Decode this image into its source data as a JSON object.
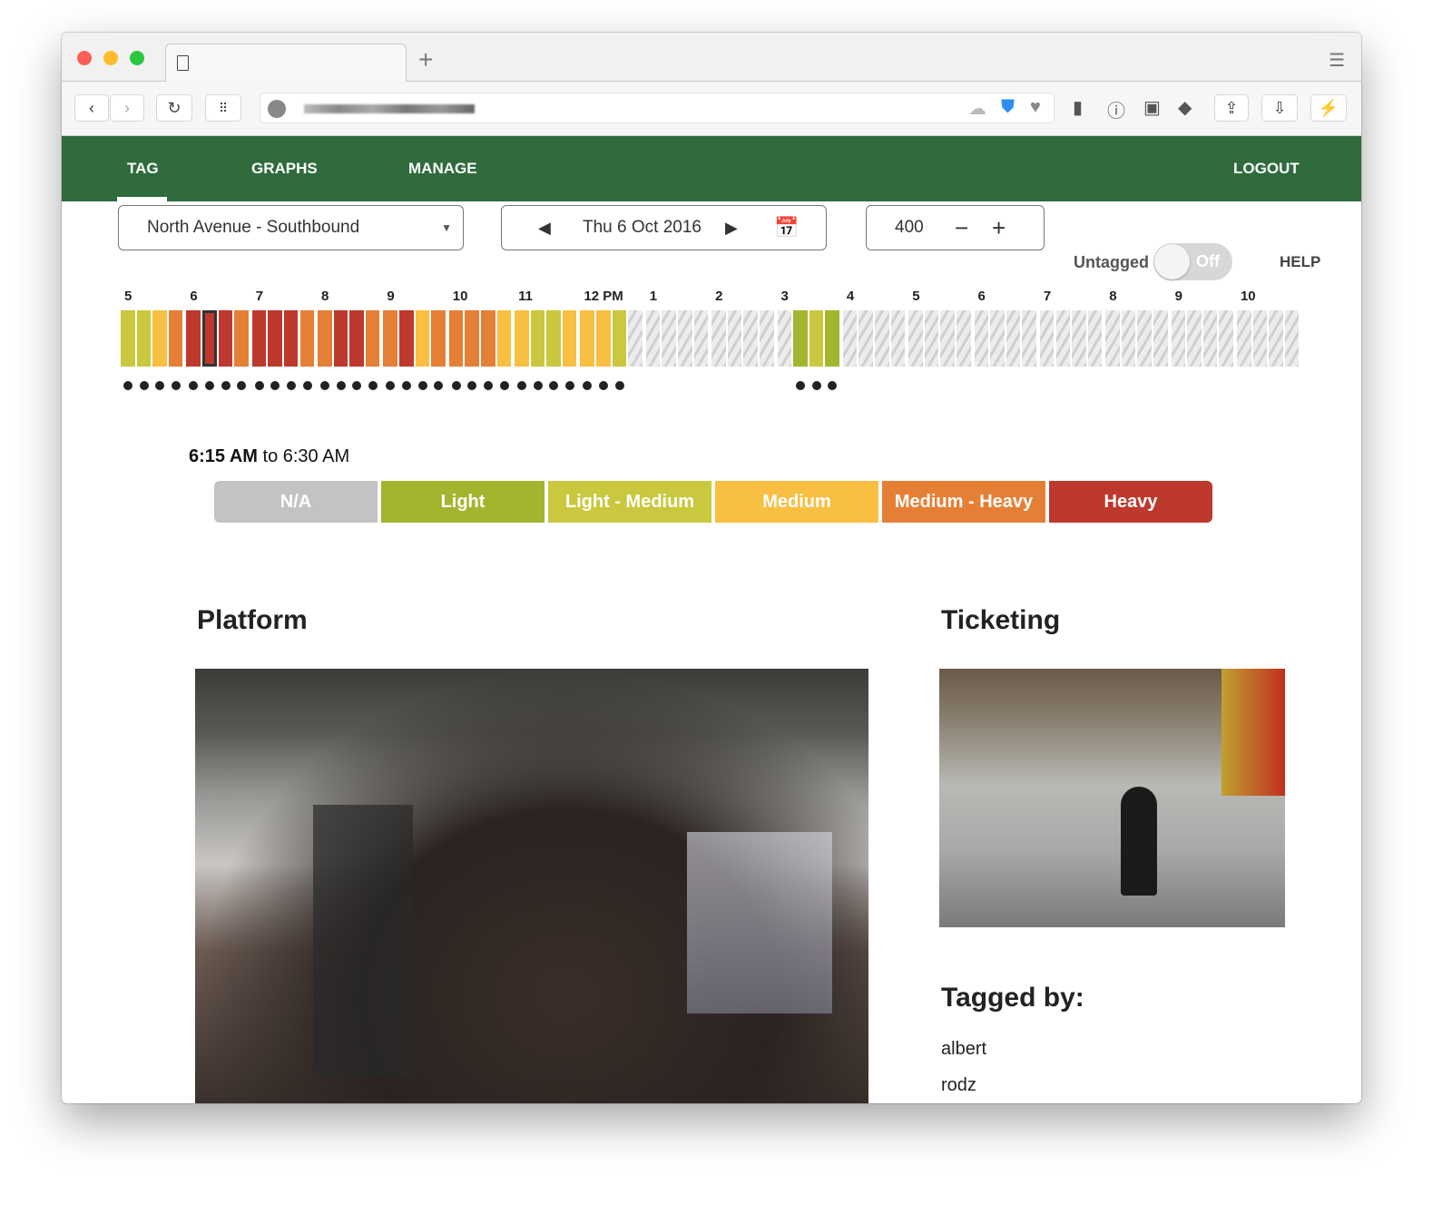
{
  "browser": {
    "new_tab": "+",
    "menu_icon": "list-icon"
  },
  "nav": {
    "items": [
      {
        "label": "TAG",
        "active": true
      },
      {
        "label": "GRAPHS"
      },
      {
        "label": "MANAGE"
      }
    ],
    "logout": "LOGOUT"
  },
  "controls": {
    "station": "North Avenue - Southbound",
    "date": "Thu 6 Oct 2016",
    "count": "400",
    "untagged_label": "Untagged",
    "toggle": "Off",
    "help": "HELP"
  },
  "colors": {
    "na": "#c3c3c3",
    "light": "#a3b52f",
    "light_medium": "#c9c83e",
    "medium": "#f8bf42",
    "medium_heavy": "#e67f36",
    "heavy": "#bd392d",
    "nav": "#2f6b3c"
  },
  "timeline": {
    "hours": [
      "5",
      "6",
      "7",
      "8",
      "9",
      "10",
      "11",
      "12 PM",
      "1",
      "2",
      "3",
      "4",
      "5",
      "6",
      "7",
      "8",
      "9",
      "10"
    ],
    "levels": [
      [
        "light_medium",
        "light_medium",
        "medium",
        "medium_heavy"
      ],
      [
        "heavy",
        "heavy",
        "heavy",
        "medium_heavy"
      ],
      [
        "heavy",
        "heavy",
        "heavy",
        "medium_heavy"
      ],
      [
        "medium_heavy",
        "heavy",
        "heavy",
        "medium_heavy"
      ],
      [
        "medium_heavy",
        "heavy",
        "medium",
        "medium_heavy"
      ],
      [
        "medium_heavy",
        "medium_heavy",
        "medium_heavy",
        "medium"
      ],
      [
        "medium",
        "light_medium",
        "light_medium",
        "medium"
      ],
      [
        "medium",
        "medium",
        "light_medium",
        "untagged"
      ],
      [
        "untagged",
        "untagged",
        "untagged",
        "untagged"
      ],
      [
        "untagged",
        "untagged",
        "untagged",
        "untagged"
      ],
      [
        "untagged",
        "light",
        "light_medium",
        "light"
      ],
      [
        "untagged",
        "untagged",
        "untagged",
        "untagged"
      ],
      [
        "untagged",
        "untagged",
        "untagged",
        "untagged"
      ],
      [
        "untagged",
        "untagged",
        "untagged",
        "untagged"
      ],
      [
        "untagged",
        "untagged",
        "untagged",
        "untagged"
      ],
      [
        "untagged",
        "untagged",
        "untagged",
        "untagged"
      ],
      [
        "untagged",
        "untagged",
        "untagged",
        "untagged"
      ],
      [
        "untagged",
        "untagged",
        "untagged",
        "untagged"
      ]
    ],
    "selected": "6:15 AM",
    "range_start": "6:15 AM",
    "range_to": " to ",
    "range_end": "6:30 AM"
  },
  "legend": [
    {
      "key": "na",
      "label": "N/A"
    },
    {
      "key": "light",
      "label": "Light"
    },
    {
      "key": "light_medium",
      "label": "Light - Medium"
    },
    {
      "key": "medium",
      "label": "Medium"
    },
    {
      "key": "medium_heavy",
      "label": "Medium - Heavy"
    },
    {
      "key": "heavy",
      "label": "Heavy"
    }
  ],
  "platform": {
    "title": "Platform"
  },
  "ticketing": {
    "title": "Ticketing"
  },
  "tagged_by": {
    "title": "Tagged by:",
    "users": [
      "albert",
      "rodz"
    ]
  }
}
